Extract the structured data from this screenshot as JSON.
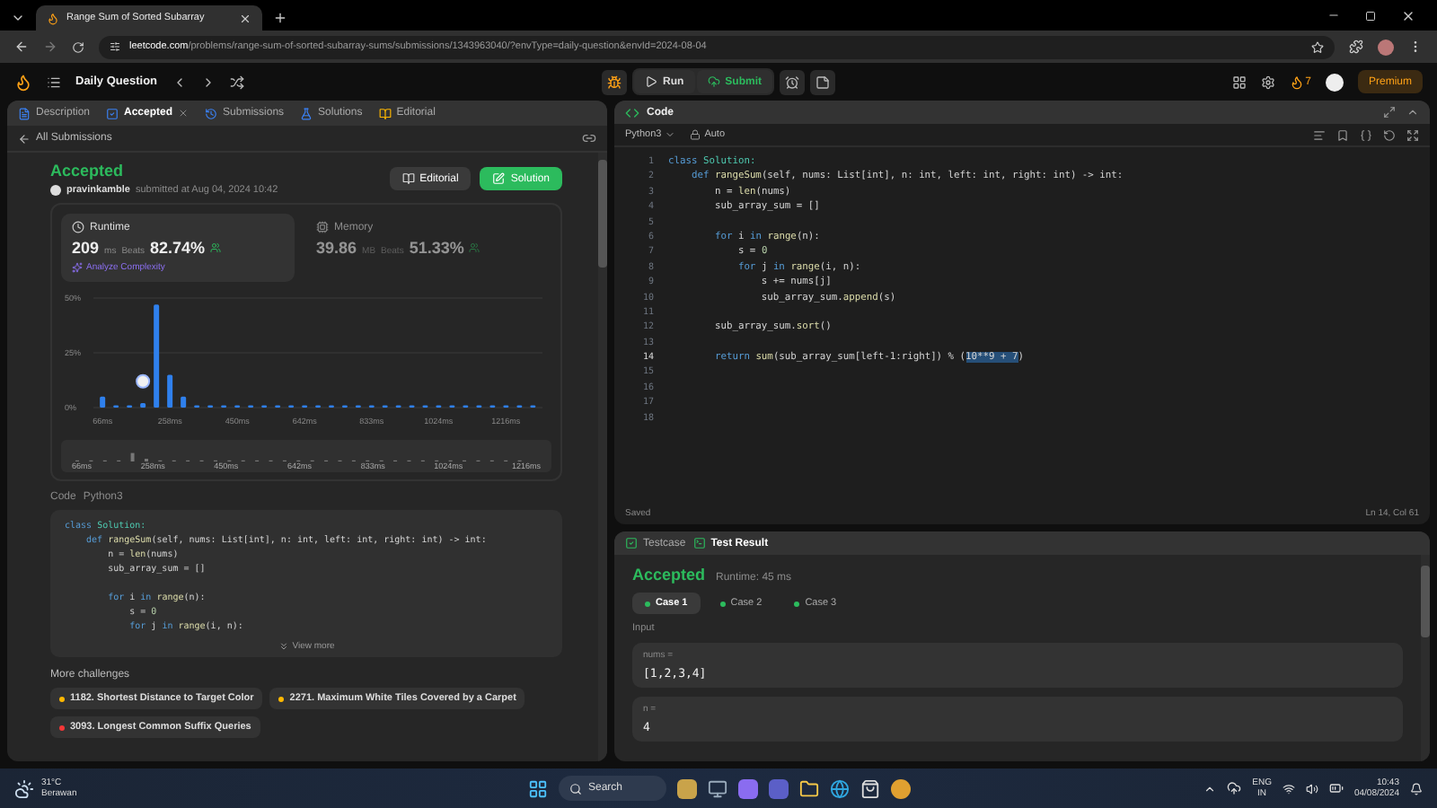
{
  "browser": {
    "tab_title": "Range Sum of Sorted Subarray",
    "url_host": "leetcode.com",
    "url_path": "/problems/range-sum-of-sorted-subarray-sums/submissions/1343963040/?envType=daily-question&envId=2024-08-04"
  },
  "nav": {
    "title": "Daily Question",
    "run": "Run",
    "submit": "Submit",
    "streak": "7",
    "premium": "Premium"
  },
  "left_tabs": [
    {
      "kind": "description",
      "label": "Description",
      "selected": false,
      "closable": false
    },
    {
      "kind": "accepted",
      "label": "Accepted",
      "selected": true,
      "closable": true
    },
    {
      "kind": "submissions",
      "label": "Submissions",
      "selected": false,
      "closable": false
    },
    {
      "kind": "solutions",
      "label": "Solutions",
      "selected": false,
      "closable": false
    },
    {
      "kind": "editorial",
      "label": "Editorial",
      "selected": false,
      "closable": false
    }
  ],
  "back_link": "All Submissions",
  "submission": {
    "status": "Accepted",
    "user": "pravinkamble",
    "submitted": "submitted at Aug 04, 2024 10:42",
    "editorial_button": "Editorial",
    "solution_button": "Solution"
  },
  "stats": [
    {
      "kind": "runtime",
      "title": "Runtime",
      "value": "209",
      "unit": "ms",
      "beats_label": "Beats",
      "beats": "82.74%",
      "selected": true
    },
    {
      "kind": "memory",
      "title": "Memory",
      "value": "39.86",
      "unit": "MB",
      "beats_label": "Beats",
      "beats": "51.33%",
      "selected": false
    }
  ],
  "analyze_link": "Analyze Complexity",
  "chart_data": {
    "type": "bar",
    "x": [
      66,
      104.4,
      142.8,
      181.2,
      219.6,
      258,
      296.4,
      334.8,
      373.2,
      411.6,
      450,
      488.4,
      526.8,
      565.2,
      603.6,
      642,
      680.2,
      718.4,
      756.6,
      794.8,
      833,
      871.2,
      909.4,
      947.6,
      985.8,
      1024,
      1062.4,
      1100.8,
      1139.2,
      1177.6,
      1216,
      1254.4,
      1292.8
    ],
    "series": [
      {
        "color": "#2f80ed",
        "values": [
          5,
          1,
          1,
          2,
          47,
          15,
          5,
          1,
          1,
          1,
          1,
          1,
          1,
          1,
          1,
          1,
          1,
          1,
          1,
          1,
          1,
          1,
          1,
          1,
          1,
          1,
          1,
          1,
          1,
          1,
          1,
          1,
          1
        ]
      }
    ],
    "xlim": [
      40,
      1320
    ],
    "ylim": [
      0,
      50
    ],
    "yticks": [
      {
        "value": 0,
        "label": "0%"
      },
      {
        "value": 25,
        "label": "25%"
      },
      {
        "value": 50,
        "label": "50%"
      }
    ],
    "xticks": [
      {
        "value": 66,
        "label": "66ms"
      },
      {
        "value": 258,
        "label": "258ms"
      },
      {
        "value": 450,
        "label": "450ms"
      },
      {
        "value": 642,
        "label": "642ms"
      },
      {
        "value": 833,
        "label": "833ms"
      },
      {
        "value": 1024,
        "label": "1024ms"
      },
      {
        "value": 1216,
        "label": "1216ms"
      }
    ]
  },
  "range_labels": [
    "66ms",
    "258ms",
    "450ms",
    "642ms",
    "833ms",
    "1024ms",
    "1216ms"
  ],
  "code_preview": {
    "label": "Code",
    "language": "Python3",
    "view_more": "View more",
    "blocks": [
      {
        "lines": [
          {
            "tokens": [
              {
                "kind": "kw",
                "text": "class "
              },
              {
                "kind": "cls",
                "text": "Solution:"
              }
            ]
          },
          {
            "tokens": [
              {
                "kind": "kw",
                "text": "    def "
              },
              {
                "kind": "fn",
                "text": "rangeSum"
              },
              {
                "kind": "tx",
                "text": "(self, nums: List[int], n: int, left: int, right: int) -> int:"
              }
            ]
          },
          {
            "tokens": [
              {
                "kind": "tx",
                "text": "        n = "
              },
              {
                "kind": "fn",
                "text": "len"
              },
              {
                "kind": "tx",
                "text": "(nums)"
              }
            ]
          },
          {
            "tokens": [
              {
                "kind": "tx",
                "text": "        sub_array_sum = []"
              }
            ]
          }
        ]
      },
      {
        "lines": [
          {
            "tokens": [
              {
                "kind": "kw",
                "text": "        for "
              },
              {
                "kind": "tx",
                "text": "i "
              },
              {
                "kind": "kw",
                "text": "in "
              },
              {
                "kind": "fn",
                "text": "range"
              },
              {
                "kind": "tx",
                "text": "(n):"
              }
            ]
          },
          {
            "tokens": [
              {
                "kind": "tx",
                "text": "            s = "
              },
              {
                "kind": "num",
                "text": "0"
              }
            ]
          },
          {
            "tokens": [
              {
                "kind": "kw",
                "text": "            for "
              },
              {
                "kind": "tx",
                "text": "j "
              },
              {
                "kind": "kw",
                "text": "in "
              },
              {
                "kind": "fn",
                "text": "range"
              },
              {
                "kind": "tx",
                "text": "(i, n):"
              }
            ]
          }
        ]
      }
    ]
  },
  "more_challenges": {
    "title": "More challenges",
    "items": [
      {
        "label": "1182. Shortest Distance to Target Color",
        "color": "#ffb800"
      },
      {
        "label": "2271. Maximum White Tiles Covered by a Carpet",
        "color": "#ffb800"
      },
      {
        "label": "3093. Longest Common Suffix Queries",
        "color": "#f63737"
      }
    ]
  },
  "editor": {
    "title": "Code",
    "language": "Python3",
    "mode": "Auto",
    "status": "Saved",
    "cursor": "Ln 14, Col 61",
    "lines": [
      {
        "number": "1",
        "current": false,
        "tokens": [
          {
            "kind": "kw",
            "text": "class "
          },
          {
            "kind": "cls",
            "text": "Solution:"
          }
        ]
      },
      {
        "number": "2",
        "current": false,
        "tokens": [
          {
            "kind": "kw",
            "text": "    def "
          },
          {
            "kind": "fn",
            "text": "rangeSum"
          },
          {
            "kind": "tx",
            "text": "(self, nums: List[int], n: int, left: int, right: int) -> int:"
          }
        ]
      },
      {
        "number": "3",
        "current": false,
        "tokens": [
          {
            "kind": "tx",
            "text": "        n = "
          },
          {
            "kind": "fn",
            "text": "len"
          },
          {
            "kind": "tx",
            "text": "(nums)"
          }
        ]
      },
      {
        "number": "4",
        "current": false,
        "tokens": [
          {
            "kind": "tx",
            "text": "        sub_array_sum = []"
          }
        ]
      },
      {
        "number": "5",
        "current": false
      },
      {
        "number": "6",
        "current": false,
        "tokens": [
          {
            "kind": "kw",
            "text": "        for "
          },
          {
            "kind": "tx",
            "text": "i "
          },
          {
            "kind": "kw",
            "text": "in "
          },
          {
            "kind": "fn",
            "text": "range"
          },
          {
            "kind": "tx",
            "text": "(n):"
          }
        ]
      },
      {
        "number": "7",
        "current": false,
        "tokens": [
          {
            "kind": "tx",
            "text": "            s = "
          },
          {
            "kind": "num",
            "text": "0"
          }
        ]
      },
      {
        "number": "8",
        "current": false,
        "tokens": [
          {
            "kind": "kw",
            "text": "            for "
          },
          {
            "kind": "tx",
            "text": "j "
          },
          {
            "kind": "kw",
            "text": "in "
          },
          {
            "kind": "fn",
            "text": "range"
          },
          {
            "kind": "tx",
            "text": "(i, n):"
          }
        ]
      },
      {
        "number": "9",
        "current": false,
        "tokens": [
          {
            "kind": "tx",
            "text": "                s += nums[j]"
          }
        ]
      },
      {
        "number": "10",
        "current": false,
        "tokens": [
          {
            "kind": "tx",
            "text": "                sub_array_sum."
          },
          {
            "kind": "fn",
            "text": "append"
          },
          {
            "kind": "tx",
            "text": "(s)"
          }
        ]
      },
      {
        "number": "11",
        "current": false
      },
      {
        "number": "12",
        "current": false,
        "tokens": [
          {
            "kind": "tx",
            "text": "        sub_array_sum."
          },
          {
            "kind": "fn",
            "text": "sort"
          },
          {
            "kind": "tx",
            "text": "()"
          }
        ]
      },
      {
        "number": "13",
        "current": false
      },
      {
        "number": "14",
        "current": true,
        "tokens": [
          {
            "kind": "kw",
            "text": "        return "
          },
          {
            "kind": "fn",
            "text": "sum"
          },
          {
            "kind": "tx",
            "text": "(sub_array_sum[left-1:right]) % ("
          },
          {
            "kind": "sel",
            "text": "10**9 + 7"
          },
          {
            "kind": "tx",
            "text": ")"
          }
        ]
      },
      {
        "number": "15",
        "current": false
      },
      {
        "number": "16",
        "current": false
      },
      {
        "number": "17",
        "current": false
      },
      {
        "number": "18",
        "current": false
      }
    ]
  },
  "result_tabs": [
    {
      "kind": "testcase",
      "label": "Testcase",
      "selected": false
    },
    {
      "kind": "result",
      "label": "Test Result",
      "selected": true
    }
  ],
  "result": {
    "status": "Accepted",
    "runtime": "Runtime: 45 ms",
    "cases": [
      {
        "label": "Case 1",
        "selected": true
      },
      {
        "label": "Case 2",
        "selected": false
      },
      {
        "label": "Case 3",
        "selected": false
      }
    ],
    "input_label": "Input",
    "inputs": [
      {
        "name": "nums =",
        "value": "[1,2,3,4]"
      },
      {
        "name": "n =",
        "value": "4"
      }
    ]
  },
  "taskbar": {
    "temperature": "31°C",
    "weather": "Berawan",
    "search": "Search",
    "language": "ENG",
    "region": "IN",
    "time": "10:43",
    "date": "04/08/2024"
  }
}
